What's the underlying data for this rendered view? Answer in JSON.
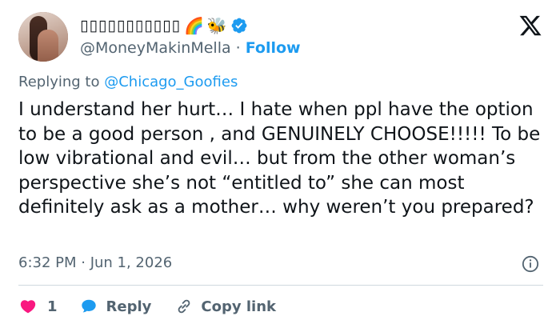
{
  "user": {
    "display_name": "▯▯▯▯▯▯▯▯▯▯▯",
    "display_emoji": [
      "🌈",
      "🐝"
    ],
    "handle": "@MoneyMakinMella",
    "separator": "·",
    "follow_label": "Follow",
    "verified": true
  },
  "reply_context": {
    "prefix": "Replying to",
    "mention": "@Chicago_Goofies"
  },
  "tweet": {
    "text": "I understand her hurt… I hate when ppl have the option to be a good person , and GENUINELY CHOOSE!!!!! To be low vibrational and evil… but from the other woman’s perspective she’s not “entitled to” she can most definitely ask as a mother… why weren’t you prepared?",
    "timestamp": "6:32 PM · Jun 1, 2026"
  },
  "actions": {
    "like_count": "1",
    "reply_label": "Reply",
    "copy_link_label": "Copy link"
  },
  "icons": {
    "brand": "x-logo-icon",
    "verified": "verified-badge-icon",
    "info": "info-icon",
    "like": "heart-icon",
    "reply": "speech-bubble-icon",
    "copy": "link-icon"
  },
  "colors": {
    "accent": "#1d9bf0",
    "text": "#0f1419",
    "muted": "#536471",
    "like": "#f91880",
    "divider": "#cfd9de"
  }
}
